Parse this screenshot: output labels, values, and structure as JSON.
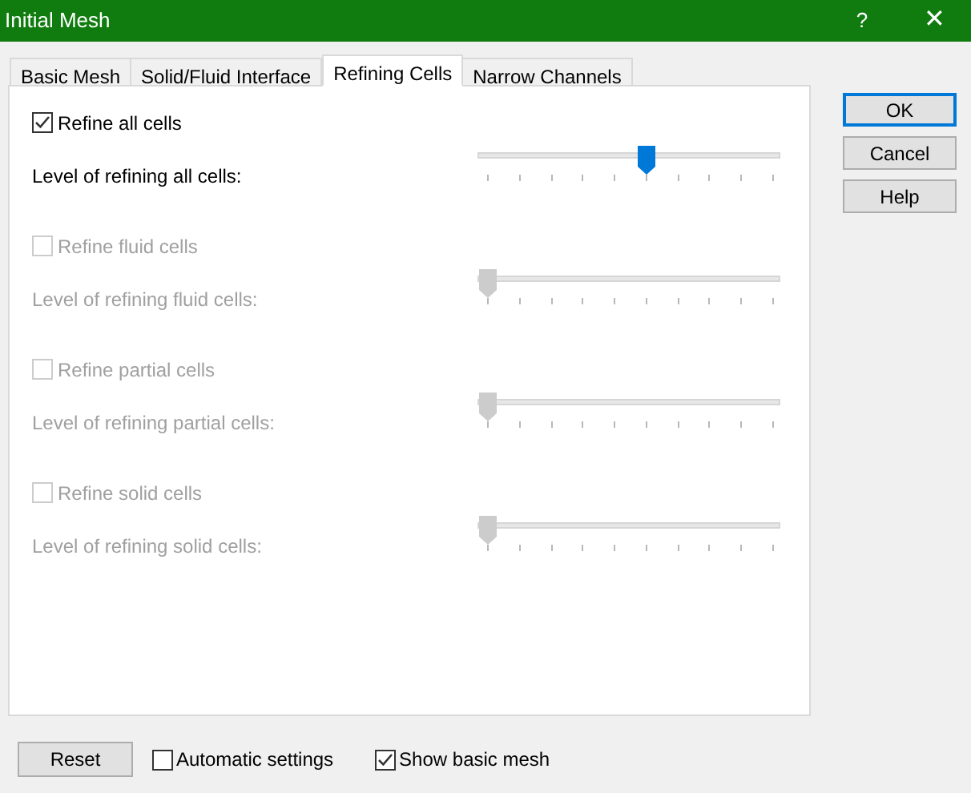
{
  "window": {
    "title": "Initial Mesh",
    "help": "?",
    "close": "✕"
  },
  "tabs": [
    {
      "label": "Basic Mesh",
      "selected": false
    },
    {
      "label": "Solid/Fluid Interface",
      "selected": false
    },
    {
      "label": "Refining Cells",
      "selected": true
    },
    {
      "label": "Narrow Channels",
      "selected": false
    }
  ],
  "groups": [
    {
      "checkbox": "Refine all cells",
      "checked": true,
      "disabled": false,
      "slider_label": "Level of refining all cells:",
      "level": 0.555
    },
    {
      "checkbox": "Refine fluid cells",
      "checked": false,
      "disabled": true,
      "slider_label": "Level of refining fluid cells:",
      "level": 0
    },
    {
      "checkbox": "Refine partial cells",
      "checked": false,
      "disabled": true,
      "slider_label": "Level of refining partial cells:",
      "level": 0
    },
    {
      "checkbox": "Refine solid cells",
      "checked": false,
      "disabled": true,
      "slider_label": "Level of refining solid cells:",
      "level": 0
    }
  ],
  "buttons": [
    {
      "label": "OK",
      "default": true
    },
    {
      "label": "Cancel",
      "default": false
    },
    {
      "label": "Help",
      "default": false
    }
  ],
  "footer": {
    "reset": "Reset",
    "options": [
      {
        "label": "Automatic settings",
        "checked": false
      },
      {
        "label": "Show basic mesh",
        "checked": true
      }
    ]
  }
}
